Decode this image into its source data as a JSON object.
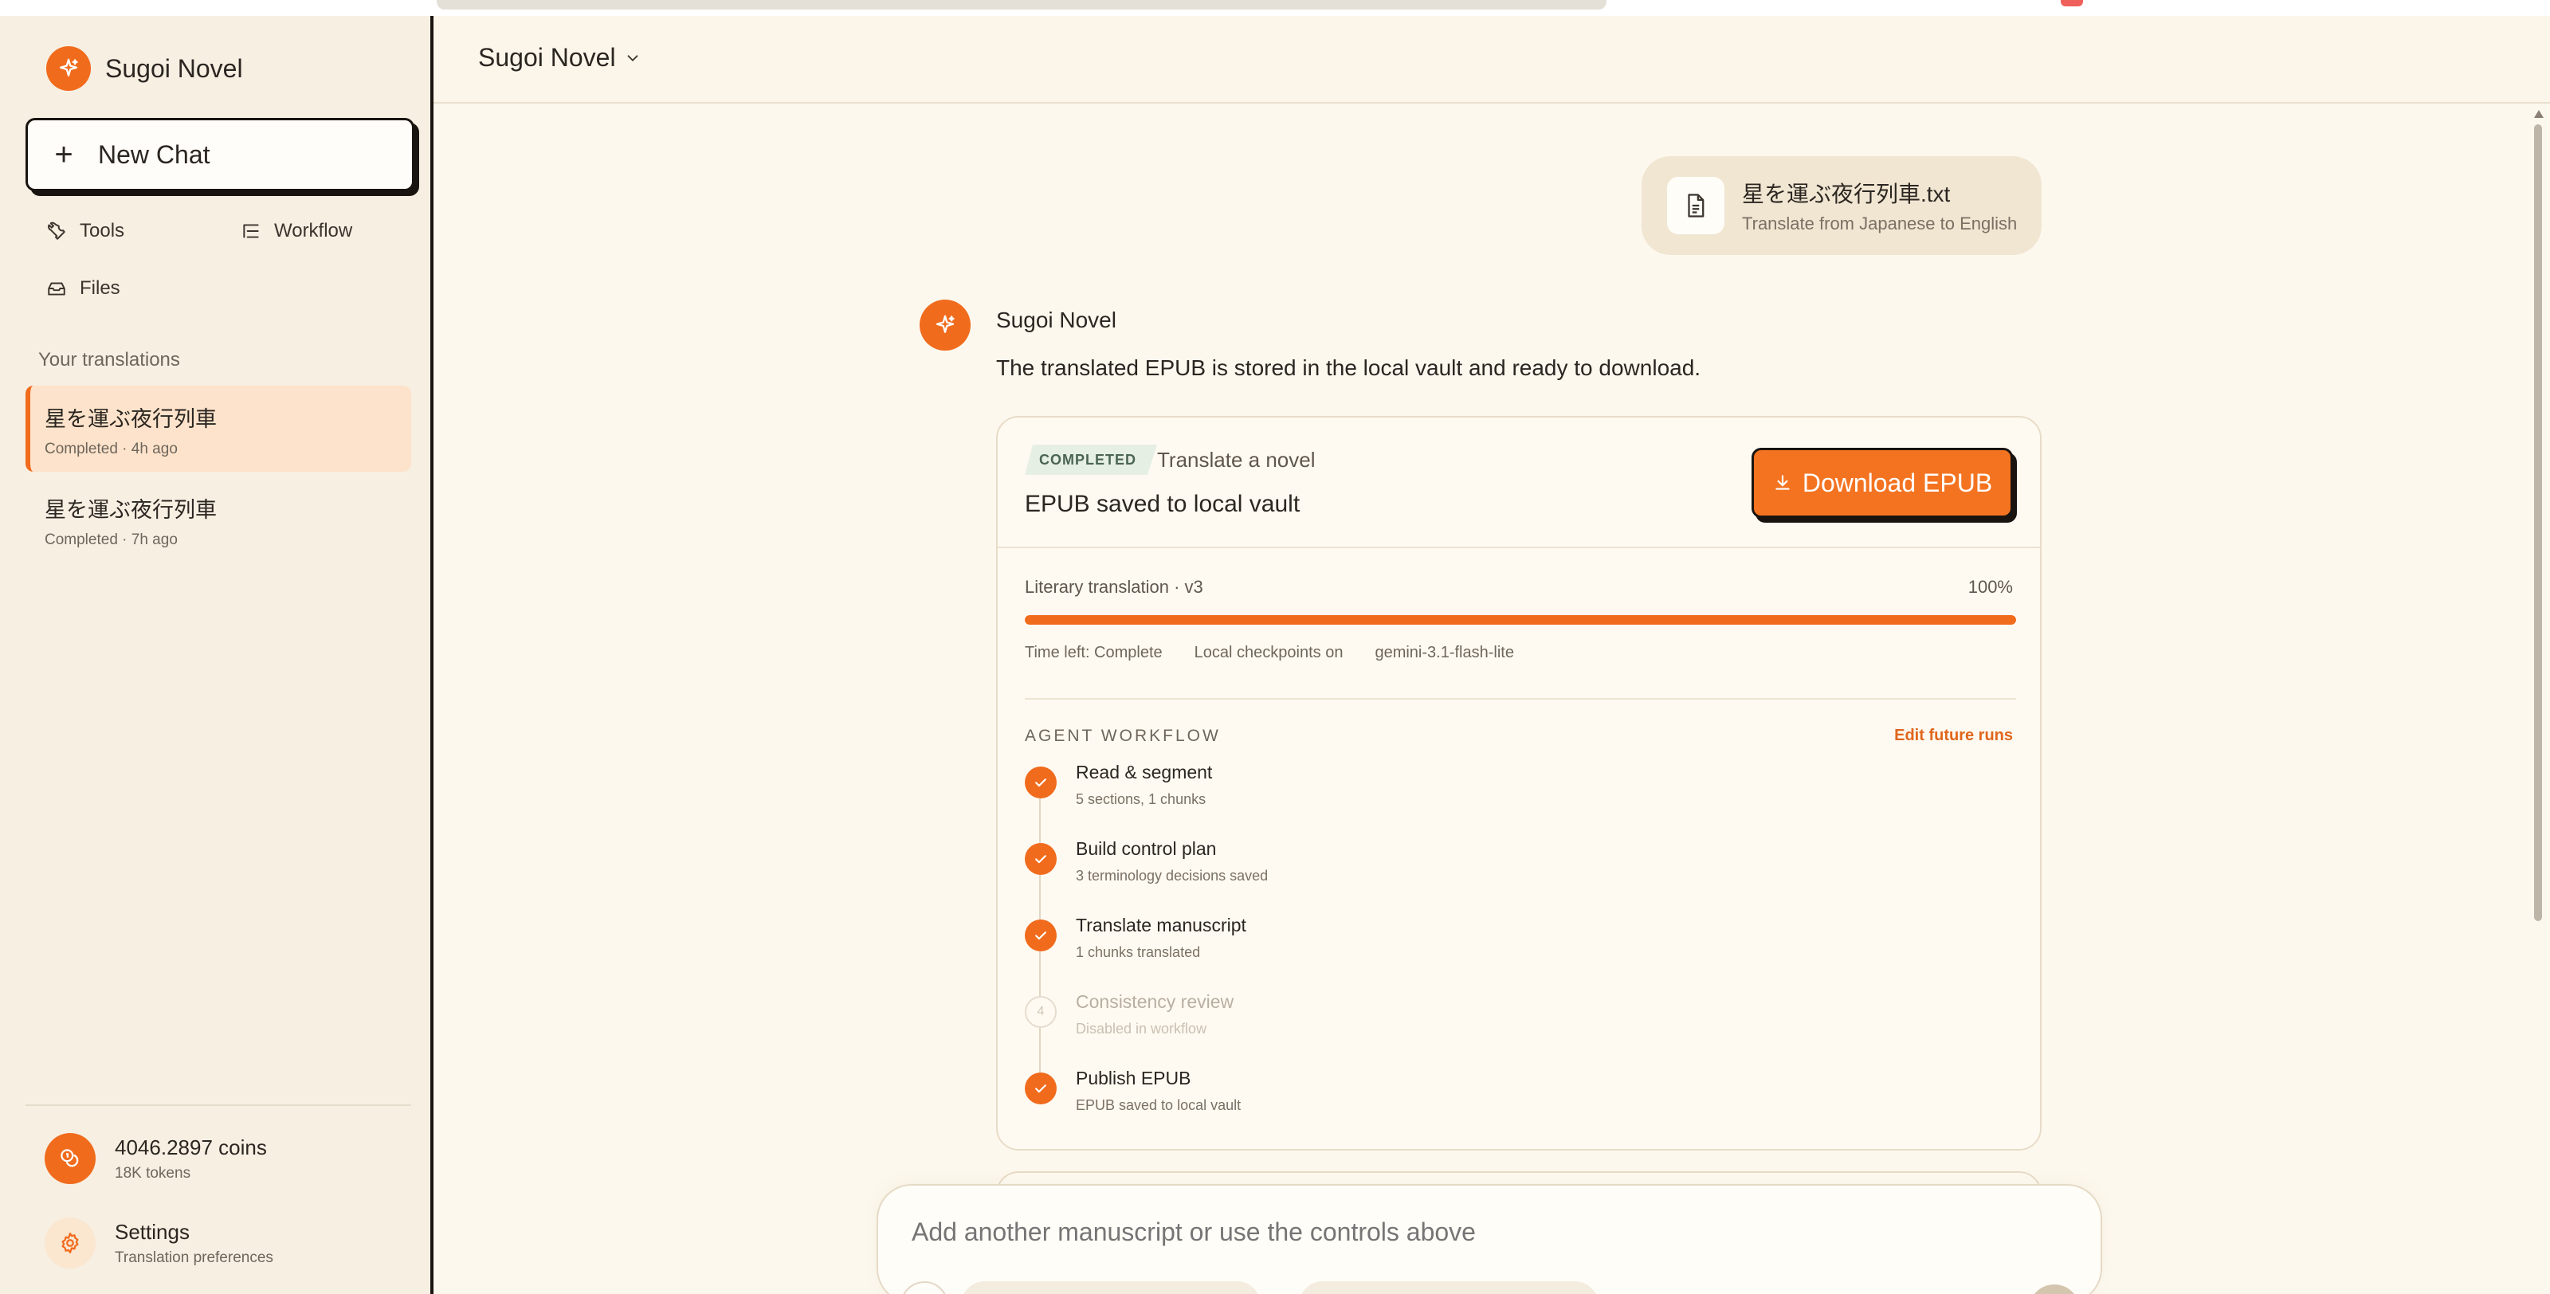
{
  "app": {
    "name": "Sugoi Novel"
  },
  "sidebar": {
    "new_chat_label": "New Chat",
    "nav": {
      "tools": "Tools",
      "workflow": "Workflow",
      "files": "Files"
    },
    "section_label": "Your translations",
    "conversations": [
      {
        "title": "星を運ぶ夜行列車",
        "meta": "Completed · 4h ago",
        "active": true
      },
      {
        "title": "星を運ぶ夜行列車",
        "meta": "Completed · 7h ago",
        "active": false
      }
    ],
    "coins": {
      "amount": "4046.2897 coins",
      "tokens": "18K tokens"
    },
    "settings": {
      "label": "Settings",
      "sub": "Translation preferences"
    }
  },
  "header": {
    "model_label": "Sugoi Novel"
  },
  "chat": {
    "file": {
      "name": "星を運ぶ夜行列車.txt",
      "description": "Translate from Japanese to English"
    },
    "assistant": {
      "name": "Sugoi Novel",
      "message": "The translated EPUB is stored in the local vault and ready to download."
    },
    "card": {
      "status_badge": "COMPLETED",
      "task_caption": "Translate a novel",
      "title": "EPUB saved to local vault",
      "download_label": "Download EPUB",
      "progress": {
        "label": "Literary translation · v3",
        "percent_text": "100%",
        "value": 1.0,
        "time_left": "Time left: Complete",
        "checkpoints": "Local checkpoints on",
        "model": "gemini-3.1-flash-lite"
      },
      "workflow": {
        "label": "AGENT WORKFLOW",
        "edit_label": "Edit future runs",
        "steps": [
          {
            "title": "Read & segment",
            "detail": "5 sections, 1 chunks",
            "status": "done"
          },
          {
            "title": "Build control plan",
            "detail": "3 terminology decisions saved",
            "status": "done"
          },
          {
            "title": "Translate manuscript",
            "detail": "1 chunks translated",
            "status": "done"
          },
          {
            "title": "Consistency review",
            "detail": "Disabled in workflow",
            "status": "disabled",
            "index": "4"
          },
          {
            "title": "Publish EPUB",
            "detail": "EPUB saved to local vault",
            "status": "done"
          }
        ]
      }
    }
  },
  "composer": {
    "placeholder": "Add another manuscript or use the controls above"
  },
  "colors": {
    "accent": "#f06b1c",
    "background": "#fdf8ee",
    "sidebar": "#f7efe2"
  }
}
